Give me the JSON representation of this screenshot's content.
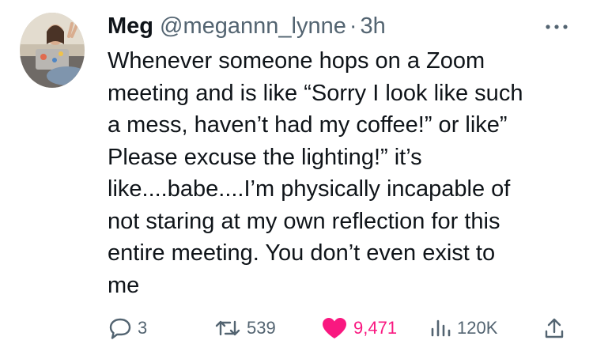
{
  "tweet": {
    "author_name": "Meg",
    "handle": "@megannn_lynne",
    "separator": "·",
    "time": "3h",
    "text": "Whenever someone hops on a Zoom\nmeeting and is like “Sorry I look like such\na mess, haven’t had my coffee!” or like”\nPlease excuse the lighting!” it’s\nlike....babe....I’m physically incapable of\nnot staring at my own reflection for this\nentire meeting. You don’t even exist to\nme"
  },
  "actions": {
    "replies": "3",
    "retweets": "539",
    "likes": "9,471",
    "views": "120K"
  },
  "icons": {
    "more": "more-dots-icon",
    "reply": "reply-icon",
    "retweet": "retweet-icon",
    "like": "heart-icon",
    "views": "views-chart-icon",
    "share": "share-icon"
  },
  "colors": {
    "text": "#0f1419",
    "secondary": "#536471",
    "like": "#f91880"
  }
}
